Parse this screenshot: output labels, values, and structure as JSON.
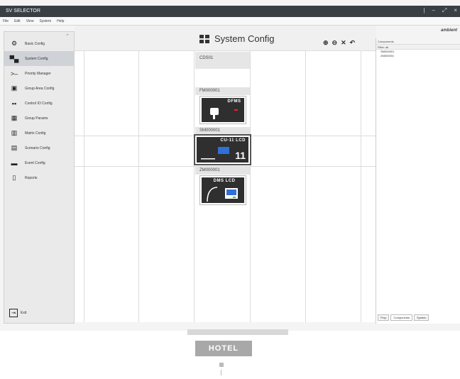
{
  "window": {
    "title": "SV SELECTOR",
    "controls": [
      "|",
      "–",
      "⤢",
      "×"
    ]
  },
  "menu": [
    "File",
    "Edit",
    "View",
    "System",
    "Help"
  ],
  "sidebar": {
    "items": [
      {
        "label": "Basic Config",
        "icon": "gears-icon",
        "glyph": "⚙"
      },
      {
        "label": "System Config",
        "icon": "system-config-icon",
        "glyph": "▀▄"
      },
      {
        "label": "Priority Manager",
        "icon": "priority-icon",
        "glyph": ">–"
      },
      {
        "label": "Group Area Config",
        "icon": "group-area-icon",
        "glyph": "▣"
      },
      {
        "label": "Control IO Config",
        "icon": "control-io-icon",
        "glyph": "▪▪"
      },
      {
        "label": "Group Params",
        "icon": "group-params-icon",
        "glyph": "▦"
      },
      {
        "label": "Matrix Config",
        "icon": "matrix-icon",
        "glyph": "▥"
      },
      {
        "label": "Scenario Config",
        "icon": "scenario-icon",
        "glyph": "▤"
      },
      {
        "label": "Event Config",
        "icon": "event-icon",
        "glyph": "▬"
      },
      {
        "label": "Reports",
        "icon": "reports-icon",
        "glyph": "▯"
      }
    ],
    "exit_label": "Exit"
  },
  "main": {
    "title": "System Config"
  },
  "devices": [
    {
      "id": "CDS01"
    },
    {
      "id": "FM000001",
      "model": "DFMS"
    },
    {
      "id": "SM000001",
      "model": "CU-11 LCD",
      "number": "11"
    },
    {
      "id": "ZM000001",
      "model": "DMS LCD"
    }
  ],
  "components": {
    "title": "Components",
    "filter": "Filter: all",
    "tree": [
      "SM000001",
      "ZM000001"
    ],
    "tabs": [
      "Prop",
      "Components",
      "System"
    ]
  },
  "logo": "ambient",
  "caption": "HOTEL",
  "colors": {
    "titlebar": "#3a3f46",
    "active": "#cfd3d8",
    "device": "#2f2f2f",
    "accent_blue": "#2f6fd6"
  }
}
